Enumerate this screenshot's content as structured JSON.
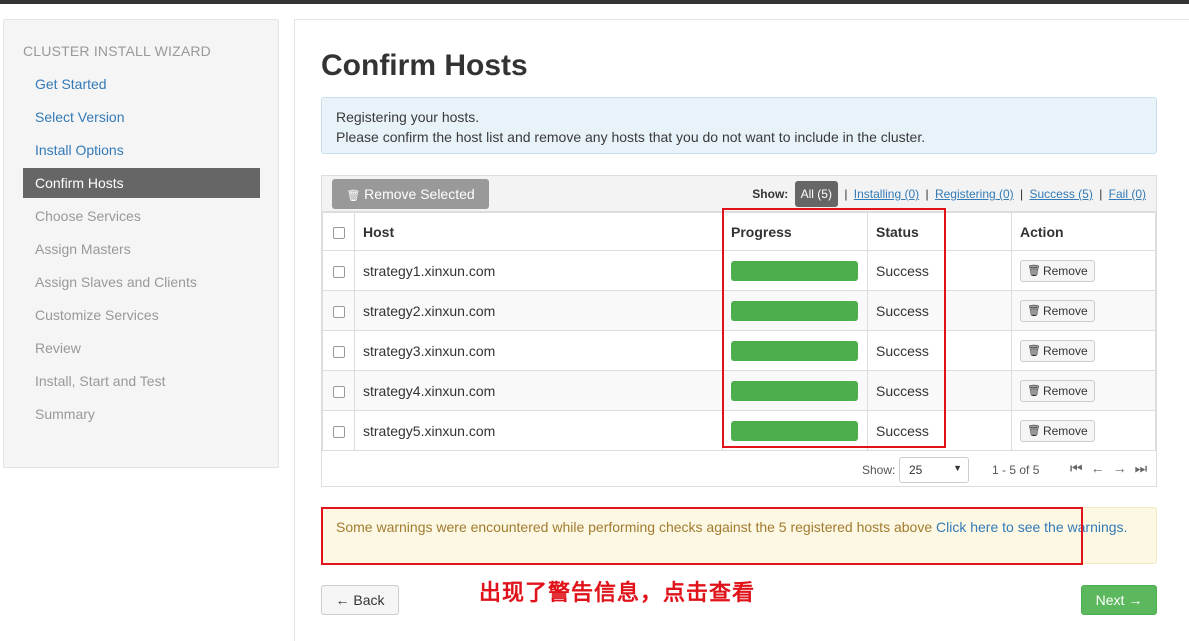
{
  "sidebar": {
    "title": "CLUSTER INSTALL WIZARD",
    "steps": [
      {
        "label": "Get Started",
        "state": "done"
      },
      {
        "label": "Select Version",
        "state": "done"
      },
      {
        "label": "Install Options",
        "state": "done"
      },
      {
        "label": "Confirm Hosts",
        "state": "active"
      },
      {
        "label": "Choose Services",
        "state": "todo"
      },
      {
        "label": "Assign Masters",
        "state": "todo"
      },
      {
        "label": "Assign Slaves and Clients",
        "state": "todo"
      },
      {
        "label": "Customize Services",
        "state": "todo"
      },
      {
        "label": "Review",
        "state": "todo"
      },
      {
        "label": "Install, Start and Test",
        "state": "todo"
      },
      {
        "label": "Summary",
        "state": "todo"
      }
    ]
  },
  "main": {
    "title": "Confirm Hosts",
    "info_line1": "Registering your hosts.",
    "info_line2": "Please confirm the host list and remove any hosts that you do not want to include in the cluster."
  },
  "toolbar": {
    "remove_selected_label": "Remove Selected",
    "show_label": "Show:",
    "filter_all": "All (5)",
    "filter_installing": "Installing (0)",
    "filter_registering": "Registering (0)",
    "filter_success": "Success (5)",
    "filter_fail": "Fail (0)"
  },
  "table": {
    "headers": {
      "host": "Host",
      "progress": "Progress",
      "status": "Status",
      "action": "Action"
    },
    "remove_label": "Remove",
    "rows": [
      {
        "host": "strategy1.xinxun.com",
        "progress": 100,
        "status": "Success"
      },
      {
        "host": "strategy2.xinxun.com",
        "progress": 100,
        "status": "Success"
      },
      {
        "host": "strategy3.xinxun.com",
        "progress": 100,
        "status": "Success"
      },
      {
        "host": "strategy4.xinxun.com",
        "progress": 100,
        "status": "Success"
      },
      {
        "host": "strategy5.xinxun.com",
        "progress": 100,
        "status": "Success"
      }
    ]
  },
  "pager": {
    "show_label": "Show:",
    "page_size": "25",
    "range": "1 - 5 of 5"
  },
  "warning": {
    "text": "Some warnings were encountered while performing checks against the 5 registered hosts above ",
    "link": "Click here to see the warnings."
  },
  "annotation": "出现了警告信息，点击查看",
  "buttons": {
    "back": "← Back",
    "next": "Next →"
  },
  "colors": {
    "success": "#5cb85c",
    "link": "#337ab7",
    "annotation_red": "#e0131b"
  }
}
